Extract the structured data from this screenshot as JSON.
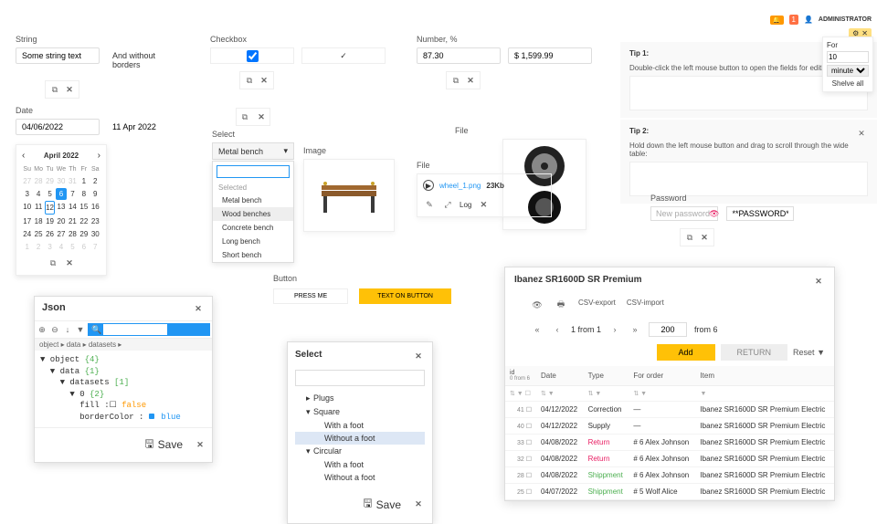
{
  "string_sec": {
    "label": "String",
    "value": "Some string text",
    "noborder": "And without borders"
  },
  "checkbox_sec": {
    "label": "Checkbox"
  },
  "number_sec": {
    "label": "Number, %",
    "val1": "87.30",
    "val2": "$ 1,599.99"
  },
  "date_sec": {
    "label": "Date",
    "val1": "04/06/2022",
    "val2": "11 Apr 2022"
  },
  "calendar": {
    "title": "April 2022",
    "dow": [
      "Su",
      "Mo",
      "Tu",
      "We",
      "Th",
      "Fr",
      "Sa"
    ],
    "weeks": [
      [
        {
          "d": "27",
          "o": 1
        },
        {
          "d": "28",
          "o": 1
        },
        {
          "d": "29",
          "o": 1
        },
        {
          "d": "30",
          "o": 1
        },
        {
          "d": "31",
          "o": 1
        },
        {
          "d": "1"
        },
        {
          "d": "2"
        }
      ],
      [
        {
          "d": "3"
        },
        {
          "d": "4"
        },
        {
          "d": "5"
        },
        {
          "d": "6",
          "sel": 1
        },
        {
          "d": "7"
        },
        {
          "d": "8"
        },
        {
          "d": "9"
        }
      ],
      [
        {
          "d": "10"
        },
        {
          "d": "11"
        },
        {
          "d": "12",
          "today": 1
        },
        {
          "d": "13"
        },
        {
          "d": "14"
        },
        {
          "d": "15"
        },
        {
          "d": "16"
        }
      ],
      [
        {
          "d": "17"
        },
        {
          "d": "18"
        },
        {
          "d": "19"
        },
        {
          "d": "20"
        },
        {
          "d": "21"
        },
        {
          "d": "22"
        },
        {
          "d": "23"
        }
      ],
      [
        {
          "d": "24"
        },
        {
          "d": "25"
        },
        {
          "d": "26"
        },
        {
          "d": "27"
        },
        {
          "d": "28"
        },
        {
          "d": "29"
        },
        {
          "d": "30"
        }
      ],
      [
        {
          "d": "1",
          "o": 1
        },
        {
          "d": "2",
          "o": 1
        },
        {
          "d": "3",
          "o": 1
        },
        {
          "d": "4",
          "o": 1
        },
        {
          "d": "5",
          "o": 1
        },
        {
          "d": "6",
          "o": 1
        },
        {
          "d": "7",
          "o": 1
        }
      ]
    ]
  },
  "select_sec": {
    "label": "Select",
    "current": "Metal bench",
    "group_selected": "Selected",
    "items_selected": [
      "Metal bench"
    ],
    "items_rest": [
      "Wood benches",
      "Concrete bench",
      "Long bench",
      "Short bench"
    ],
    "hl_index": 0
  },
  "image_sec": {
    "label": "Image"
  },
  "file_sec": {
    "label": "File",
    "name": "wheel_1.png",
    "size": "23Kb",
    "log": "Log"
  },
  "tips": {
    "admin": "ADMINISTRATOR",
    "snooze": {
      "for": "For",
      "val": "10",
      "unit": "minutes",
      "shelve": "Shelve all"
    },
    "tip1_t": "Tip 1:",
    "tip1_b": "Double-click the left mouse button to open the fields for editing:",
    "tip2_t": "Tip 2:",
    "tip2_b": "Hold down the left mouse button and drag to scroll through the wide table:"
  },
  "password_sec": {
    "label": "Password",
    "placeholder": "New password",
    "masked": "**PASSWORD**"
  },
  "button_sec": {
    "label": "Button",
    "b1": "PRESS ME",
    "b2": "TEXT ON BUTTON"
  },
  "json_panel": {
    "title": "Json",
    "breadcrumb": "object ▸ data ▸ datasets ▸",
    "lines": [
      "▼ object {4}",
      "  ▼ data {1}",
      "    ▼ datasets [1]",
      "      ▼ 0 {2}",
      "        fill :☐ false",
      "        borderColor : ■ blue"
    ],
    "save": "Save"
  },
  "select2": {
    "title": "Select",
    "items": [
      {
        "text": "Plugs",
        "lvl": 1,
        "caret": "▸"
      },
      {
        "text": "Square",
        "lvl": 1,
        "caret": "▾"
      },
      {
        "text": "With a foot",
        "lvl": 2
      },
      {
        "text": "Without a foot",
        "lvl": 2,
        "hl": 1
      },
      {
        "text": "Circular",
        "lvl": 1,
        "caret": "▾"
      },
      {
        "text": "With a foot",
        "lvl": 2
      },
      {
        "text": "Without a foot",
        "lvl": 2
      }
    ],
    "save": "Save"
  },
  "modal": {
    "title": "Ibanez SR1600D SR Premium",
    "csv_export": "CSV-export",
    "csv_import": "CSV-import",
    "page_text": "1 from 1",
    "qty": "200",
    "from_text": "from 6",
    "add": "Add",
    "return": "RETURN",
    "reset": "Reset",
    "cols": {
      "id": "id",
      "idsub": "0 from 6",
      "date": "Date",
      "type": "Type",
      "order": "For order",
      "item": "Item"
    },
    "rows": [
      {
        "id": "41",
        "date": "04/12/2022",
        "type": "Correction",
        "order": "—",
        "item": "Ibanez SR1600D SR Premium Electric"
      },
      {
        "id": "40",
        "date": "04/12/2022",
        "type": "Supply",
        "order": "—",
        "item": "Ibanez SR1600D SR Premium Electric"
      },
      {
        "id": "33",
        "date": "04/08/2022",
        "type": "Return",
        "order": "# 6 Alex Johnson",
        "item": "Ibanez SR1600D SR Premium Electric"
      },
      {
        "id": "32",
        "date": "04/08/2022",
        "type": "Return",
        "order": "# 6 Alex Johnson",
        "item": "Ibanez SR1600D SR Premium Electric"
      },
      {
        "id": "28",
        "date": "04/08/2022",
        "type": "Shippment",
        "order": "# 6 Alex Johnson",
        "item": "Ibanez SR1600D SR Premium Electric"
      },
      {
        "id": "25",
        "date": "04/07/2022",
        "type": "Shippment",
        "order": "# 5 Wolf Alice",
        "item": "Ibanez SR1600D SR Premium Electric"
      }
    ]
  }
}
